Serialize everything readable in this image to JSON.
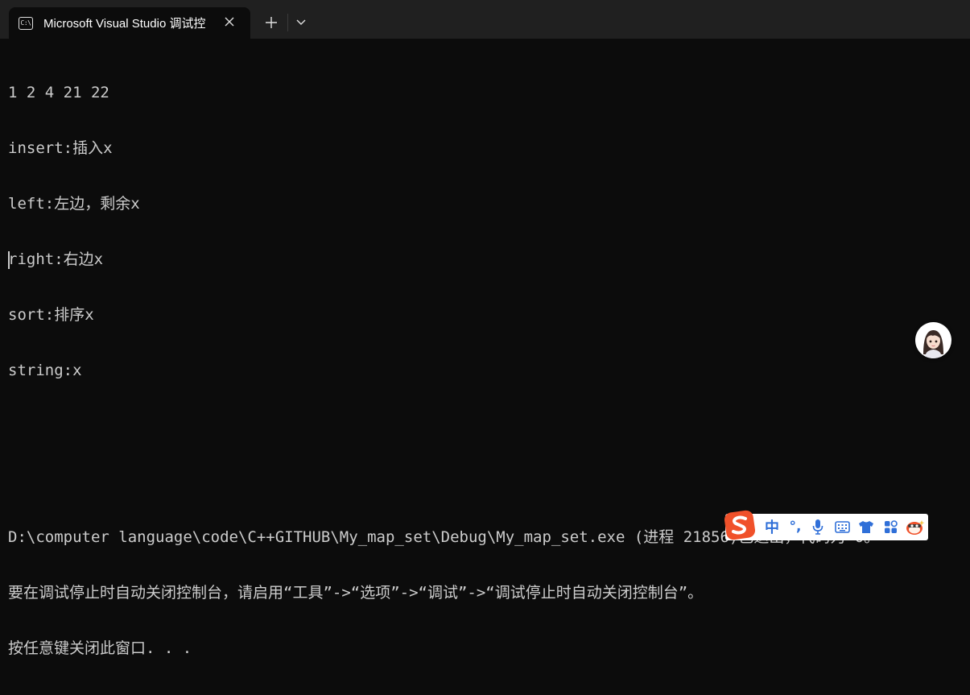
{
  "window": {
    "tab_title": "Microsoft Visual Studio 调试控",
    "tab_icon": "console-icon",
    "tab_icon_text": "C:\\"
  },
  "console": {
    "lines": [
      "1 2 4 21 22",
      "insert:插入x",
      "left:左边，剩余x",
      "right:右边x",
      "sort:排序x",
      "string:x",
      "",
      "",
      "D:\\computer language\\code\\C++GITHUB\\My_map_set\\Debug\\My_map_set.exe (进程 21856)已退出，代码为 0。",
      "要在调试停止时自动关闭控制台，请启用“工具”->“选项”->“调试”->“调试停止时自动关闭控制台”。",
      "按任意键关闭此窗口. . ."
    ]
  },
  "ime_toolbar": {
    "logo": "sogou-s-icon",
    "language": "中",
    "punctuation": "°,",
    "icons": [
      "microphone-icon",
      "keyboard-icon",
      "shirt-skin-icon",
      "apps-grid-icon",
      "mascot-icon"
    ]
  },
  "colors": {
    "background": "#0c0c0c",
    "titlebar": "#202020",
    "text": "#cccccc",
    "ime_accent": "#2f6fd8",
    "sogou_orange": "#f0512a"
  }
}
